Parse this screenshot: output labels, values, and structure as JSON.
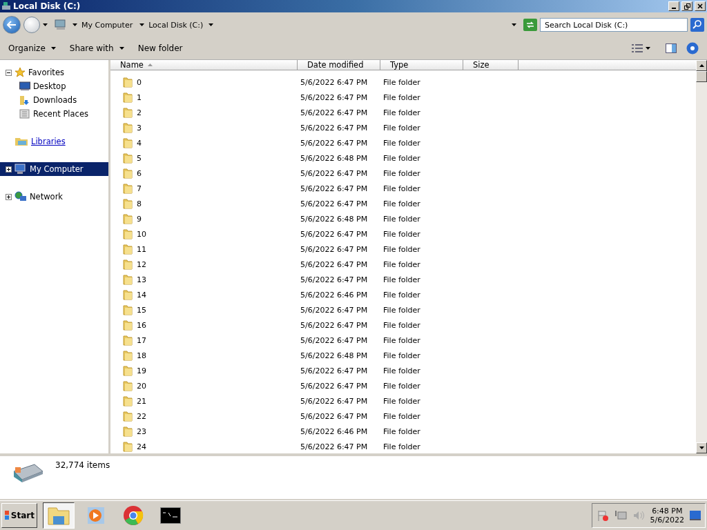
{
  "window": {
    "title": "Local Disk (C:)"
  },
  "address": {
    "crumbs": [
      "My Computer",
      "Local Disk (C:)"
    ]
  },
  "search": {
    "placeholder": "Search Local Disk (C:)"
  },
  "toolbar": {
    "buttons": [
      {
        "label": "Organize",
        "dropdown": true
      },
      {
        "label": "Share with",
        "dropdown": true
      },
      {
        "label": "New folder",
        "dropdown": false
      }
    ]
  },
  "sidebar": {
    "items": [
      {
        "label": "Favorites",
        "expanded": true,
        "selected": false,
        "hovered": false,
        "children": [
          {
            "label": "Desktop",
            "selected": false
          },
          {
            "label": "Downloads",
            "selected": false
          },
          {
            "label": "Recent Places",
            "selected": false
          }
        ]
      },
      {
        "label": "Libraries",
        "selected": false,
        "hovered": true
      },
      {
        "label": "My Computer",
        "expanded": false,
        "selected": true,
        "hovered": false
      },
      {
        "label": "Network",
        "expanded": false,
        "selected": false,
        "hovered": false
      }
    ]
  },
  "table": {
    "columns": [
      {
        "label": "Name",
        "sorted": true
      },
      {
        "label": "Date modified",
        "sorted": false
      },
      {
        "label": "Type",
        "sorted": false
      },
      {
        "label": "Size",
        "sorted": false
      }
    ],
    "rows": [
      {
        "name": "0",
        "date": "5/6/2022 6:47 PM",
        "type": "File folder"
      },
      {
        "name": "1",
        "date": "5/6/2022 6:47 PM",
        "type": "File folder"
      },
      {
        "name": "2",
        "date": "5/6/2022 6:47 PM",
        "type": "File folder"
      },
      {
        "name": "3",
        "date": "5/6/2022 6:47 PM",
        "type": "File folder"
      },
      {
        "name": "4",
        "date": "5/6/2022 6:47 PM",
        "type": "File folder"
      },
      {
        "name": "5",
        "date": "5/6/2022 6:48 PM",
        "type": "File folder"
      },
      {
        "name": "6",
        "date": "5/6/2022 6:47 PM",
        "type": "File folder"
      },
      {
        "name": "7",
        "date": "5/6/2022 6:47 PM",
        "type": "File folder"
      },
      {
        "name": "8",
        "date": "5/6/2022 6:47 PM",
        "type": "File folder"
      },
      {
        "name": "9",
        "date": "5/6/2022 6:48 PM",
        "type": "File folder"
      },
      {
        "name": "10",
        "date": "5/6/2022 6:47 PM",
        "type": "File folder"
      },
      {
        "name": "11",
        "date": "5/6/2022 6:47 PM",
        "type": "File folder"
      },
      {
        "name": "12",
        "date": "5/6/2022 6:47 PM",
        "type": "File folder"
      },
      {
        "name": "13",
        "date": "5/6/2022 6:47 PM",
        "type": "File folder"
      },
      {
        "name": "14",
        "date": "5/6/2022 6:46 PM",
        "type": "File folder"
      },
      {
        "name": "15",
        "date": "5/6/2022 6:47 PM",
        "type": "File folder"
      },
      {
        "name": "16",
        "date": "5/6/2022 6:47 PM",
        "type": "File folder"
      },
      {
        "name": "17",
        "date": "5/6/2022 6:47 PM",
        "type": "File folder"
      },
      {
        "name": "18",
        "date": "5/6/2022 6:48 PM",
        "type": "File folder"
      },
      {
        "name": "19",
        "date": "5/6/2022 6:47 PM",
        "type": "File folder"
      },
      {
        "name": "20",
        "date": "5/6/2022 6:47 PM",
        "type": "File folder"
      },
      {
        "name": "21",
        "date": "5/6/2022 6:47 PM",
        "type": "File folder"
      },
      {
        "name": "22",
        "date": "5/6/2022 6:47 PM",
        "type": "File folder"
      },
      {
        "name": "23",
        "date": "5/6/2022 6:46 PM",
        "type": "File folder"
      },
      {
        "name": "24",
        "date": "5/6/2022 6:47 PM",
        "type": "File folder"
      }
    ]
  },
  "status_bar": {
    "count": "32,774 items"
  },
  "taskbar": {
    "start": "Start",
    "apps": [
      {
        "selected": true
      },
      {
        "selected": false
      },
      {
        "selected": false
      },
      {
        "selected": false
      }
    ],
    "tray": {
      "time": "6:48 PM",
      "date": "5/6/2022"
    }
  }
}
